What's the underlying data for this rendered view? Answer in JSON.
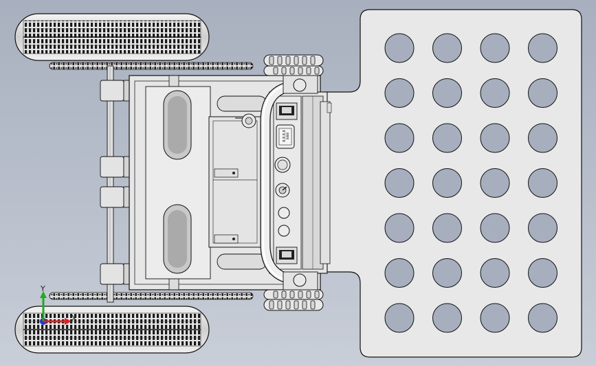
{
  "viewport": {
    "background_top": "#a8b0bf",
    "background_bottom": "#c9ced8",
    "part_fill": "#e9e9e9",
    "edge_color": "#111111",
    "hole_fill": "#a7afbf"
  },
  "triad": {
    "y_label": "Y",
    "x_label": "X",
    "y_color": "#22aa22",
    "x_color": "#dd2222",
    "z_color": "#2233cc"
  },
  "control_panel": {
    "display_text_line1": "8.8.8.8",
    "display_text_line2": "8888"
  },
  "platform": {
    "hole_rows": 7,
    "hole_cols": 4
  }
}
